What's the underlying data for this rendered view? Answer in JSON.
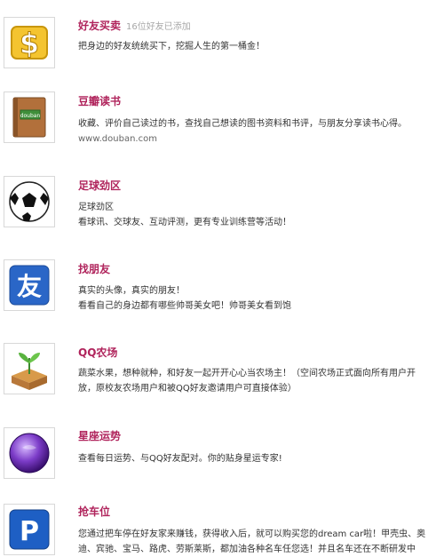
{
  "apps": [
    {
      "title": "好友买卖",
      "meta": "16位好友已添加",
      "icon": "dollar-icon",
      "desc_lines": [
        "把身边的好友统统买下，挖掘人生的第一桶金！"
      ]
    },
    {
      "title": "豆瓣读书",
      "icon": "douban-book-icon",
      "icon_text": "douban",
      "desc_lines": [
        "收藏、评价自己读过的书，查找自己想读的图书资料和书评，与朋友分享读书心得。"
      ],
      "url": "www.douban.com"
    },
    {
      "title": "足球劲区",
      "icon": "soccer-ball-icon",
      "desc_lines": [
        "足球劲区",
        "看球讯、交球友、互动评测，更有专业训练营等活动！"
      ]
    },
    {
      "title": "找朋友",
      "icon": "friend-icon",
      "icon_text": "友",
      "desc_lines": [
        "真实的头像，真实的朋友！",
        "看看自己的身边都有哪些帅哥美女吧！帅哥美女看到饱"
      ]
    },
    {
      "title": "QQ农场",
      "icon": "farm-sprout-icon",
      "desc_lines": [
        "蔬菜水果，想种就种，和好友一起开开心心当农场主！（空间农场正式面向所有用户开",
        "放，原校友农场用户和被QQ好友邀请用户可直接体验）"
      ]
    },
    {
      "title": "星座运势",
      "icon": "horoscope-orb-icon",
      "desc_lines": [
        "查看每日运势、与QQ好友配对。你的贴身星运专家!"
      ]
    },
    {
      "title": "抢车位",
      "icon": "parking-icon",
      "icon_text": "P",
      "desc_lines": [
        "您通过把车停在好友家来赚钱，获得收入后，就可以购买您的dream car啦！甲壳虫、奥",
        "迪、宾驰、宝马、路虎、劳斯莱斯，都加油各种名车任您选！并且名车还在不断研发中"
      ]
    }
  ]
}
